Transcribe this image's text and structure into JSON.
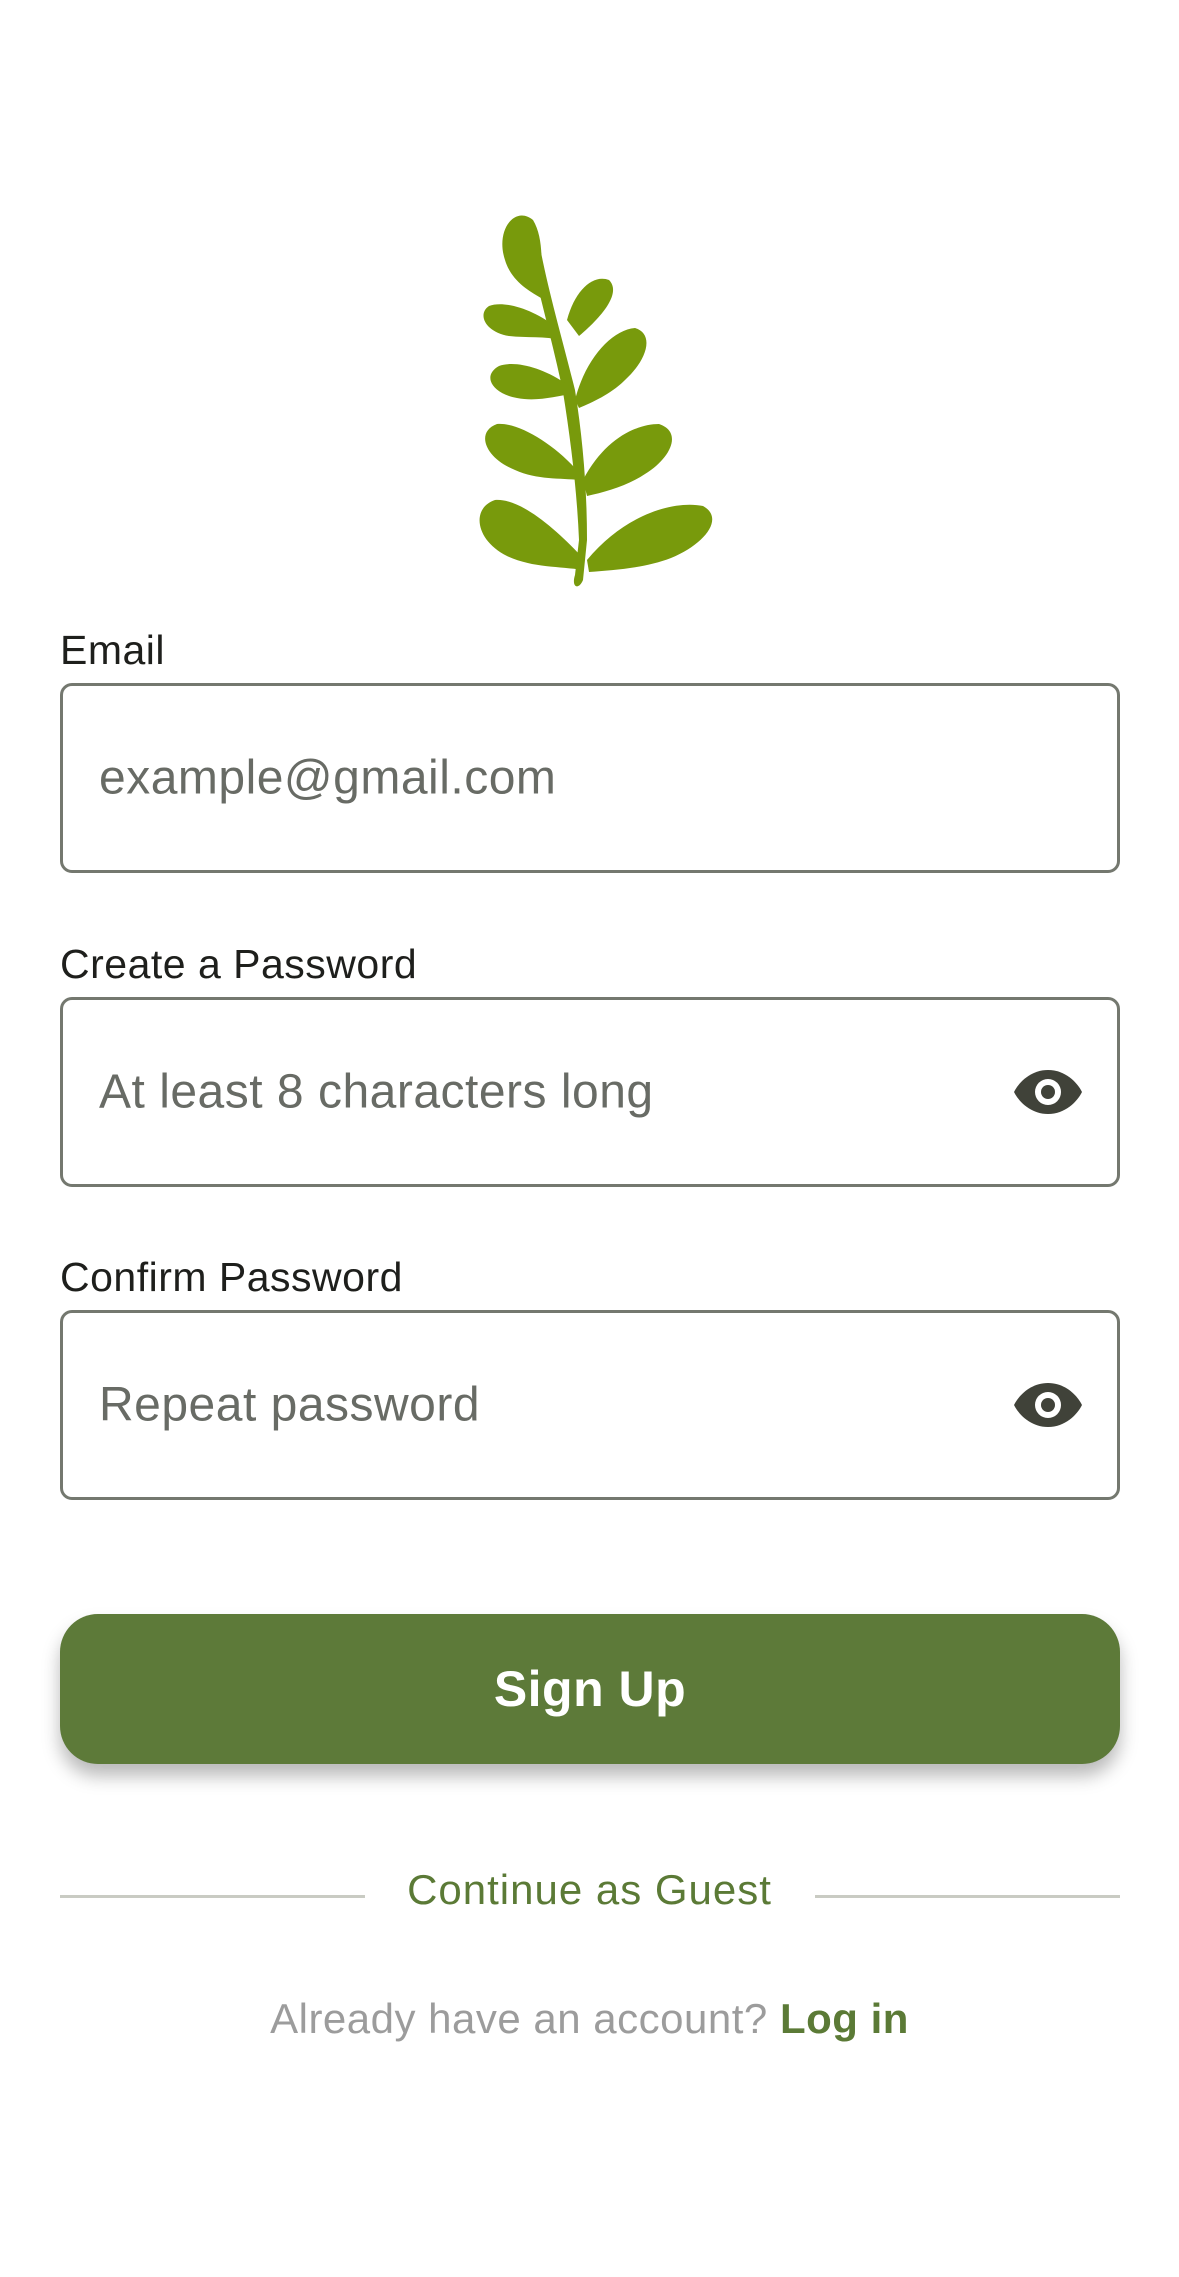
{
  "logo": {
    "icon": "leaf-icon",
    "color": "#789a0c"
  },
  "form": {
    "email": {
      "label": "Email",
      "placeholder": "example@gmail.com"
    },
    "password": {
      "label": "Create a Password",
      "placeholder": "At least 8 characters long",
      "toggle_icon": "eye-icon"
    },
    "confirm": {
      "label": "Confirm Password",
      "placeholder": "Repeat password",
      "toggle_icon": "eye-icon"
    }
  },
  "actions": {
    "signup_label": "Sign Up",
    "guest_label": "Continue as Guest",
    "login_prompt": "Already have an account?",
    "login_link": "Log in"
  },
  "colors": {
    "primary": "#5d7a39",
    "border": "#74786f",
    "placeholder": "#686b65",
    "muted": "#9c9c9c"
  }
}
